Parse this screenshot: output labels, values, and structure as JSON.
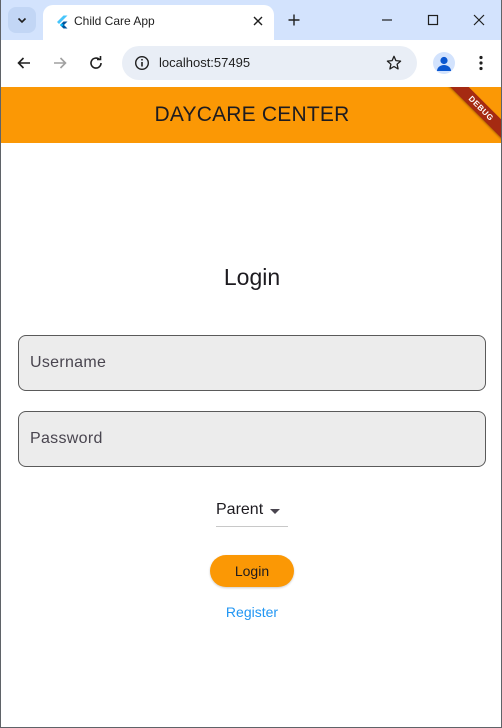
{
  "browser": {
    "tab_title": "Child Care App",
    "url": "localhost:57495"
  },
  "app": {
    "appbar_title": "DAYCARE CENTER",
    "debug_banner": "DEBUG",
    "heading": "Login",
    "username_placeholder": "Username",
    "password_placeholder": "Password",
    "role_selected": "Parent",
    "login_button": "Login",
    "register_link": "Register"
  },
  "colors": {
    "appbar": "#fb9805",
    "button": "#fb9805",
    "link": "#2196f3",
    "tabstrip": "#d3e3fd"
  },
  "icons": {
    "tab_search": "chevron-down-icon",
    "favicon": "flutter-icon",
    "tab_close": "close-icon",
    "new_tab": "plus-icon",
    "minimize": "minimize-icon",
    "maximize": "maximize-icon",
    "close_window": "close-icon",
    "back": "arrow-left-icon",
    "forward": "arrow-right-icon",
    "reload": "reload-icon",
    "site_info": "site-info-icon",
    "bookmark": "star-icon",
    "profile": "profile-icon",
    "menu": "more-vert-icon"
  }
}
